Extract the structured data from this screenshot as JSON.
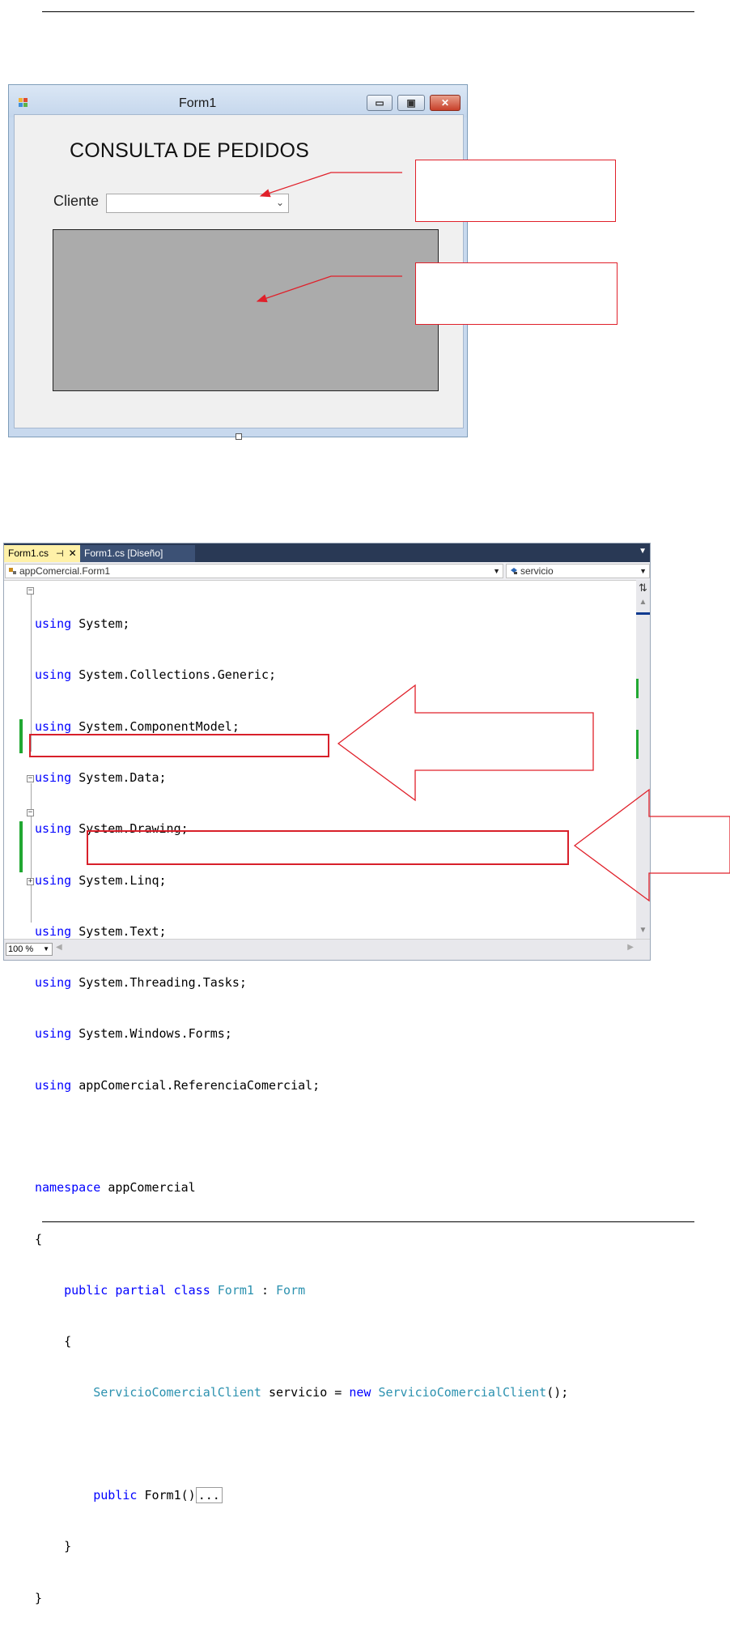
{
  "form_window": {
    "title": "Form1",
    "heading": "CONSULTA DE PEDIDOS",
    "cliente_label": "Cliente",
    "combo_value": "",
    "controls": {
      "minimize": "▭",
      "maximize": "▣",
      "close": "✕"
    }
  },
  "editor": {
    "tabs": [
      {
        "label": "Form1.cs",
        "active": true,
        "pin": "⊣",
        "close": "✕"
      },
      {
        "label": "Form1.cs [Diseño]",
        "active": false
      }
    ],
    "nav_left": "appComercial.Form1",
    "nav_right": "servicio",
    "zoom": "100 %",
    "code_lines": [
      "using System;",
      "using System.Collections.Generic;",
      "using System.ComponentModel;",
      "using System.Data;",
      "using System.Drawing;",
      "using System.Linq;",
      "using System.Text;",
      "using System.Threading.Tasks;",
      "using System.Windows.Forms;",
      "using appComercial.ReferenciaComercial;",
      "",
      "namespace appComercial",
      "{",
      "    public partial class Form1 : Form",
      "    {",
      "        ServicioComercialClient servicio = new ServicioComercialClient();",
      "",
      "        public Form1()...",
      "    }",
      "}"
    ]
  },
  "colors": {
    "keyword": "#0000ff",
    "type": "#2b91af",
    "annotation_red": "#d8202a",
    "change_marker": "#21a832"
  }
}
